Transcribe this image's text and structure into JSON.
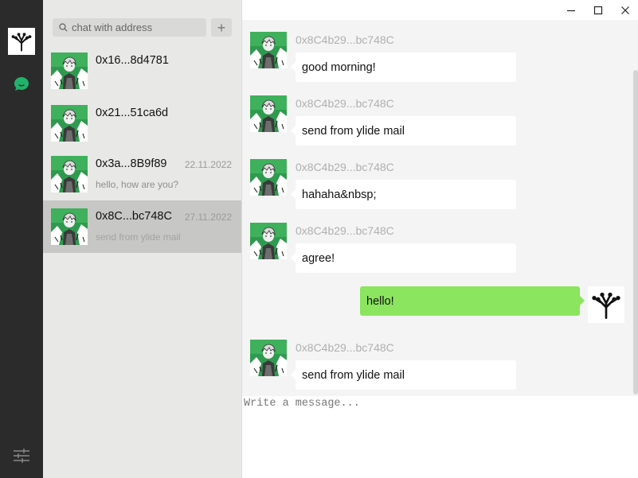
{
  "sidebar": {
    "logo_icon": "ylide-tree-logo-icon",
    "chat_icon": "chat-bubble-icon",
    "settings_icon": "sliders-icon",
    "accent_color": "#20b36b"
  },
  "search": {
    "placeholder": "chat with address",
    "add_label": "+"
  },
  "conversations": [
    {
      "address": "0x16...8d4781",
      "date": "",
      "preview": ""
    },
    {
      "address": "0x21...51ca6d",
      "date": "",
      "preview": ""
    },
    {
      "address": "0x3a...8B9f89",
      "date": "22.11.2022",
      "preview": "hello, how are you?"
    },
    {
      "address": "0x8C...bc748C",
      "date": "27.11.2022",
      "preview": "send from ylide mail",
      "selected": true
    }
  ],
  "window_controls": [
    "minimize-icon",
    "maximize-icon",
    "close-icon"
  ],
  "messages": [
    {
      "sender": "0x8C4b29...bc748C",
      "text": "good morning!",
      "mine": false
    },
    {
      "sender": "0x8C4b29...bc748C",
      "text": "send from ylide mail",
      "mine": false
    },
    {
      "sender": "0x8C4b29...bc748C",
      "text": "hahaha&nbsp;",
      "mine": false
    },
    {
      "sender": "0x8C4b29...bc748C",
      "text": "agree!",
      "mine": false
    },
    {
      "sender": "",
      "text": "hello!",
      "mine": true
    },
    {
      "sender": "0x8C4b29...bc748C",
      "text": "send from ylide mail",
      "mine": false
    }
  ],
  "composer": {
    "placeholder": "Write a message..."
  },
  "colors": {
    "outgoing_bubble": "#8be55f",
    "incoming_bubble": "#ffffff",
    "selected_conversation": "#c7c7c5",
    "rail": "#2b2b2b"
  }
}
